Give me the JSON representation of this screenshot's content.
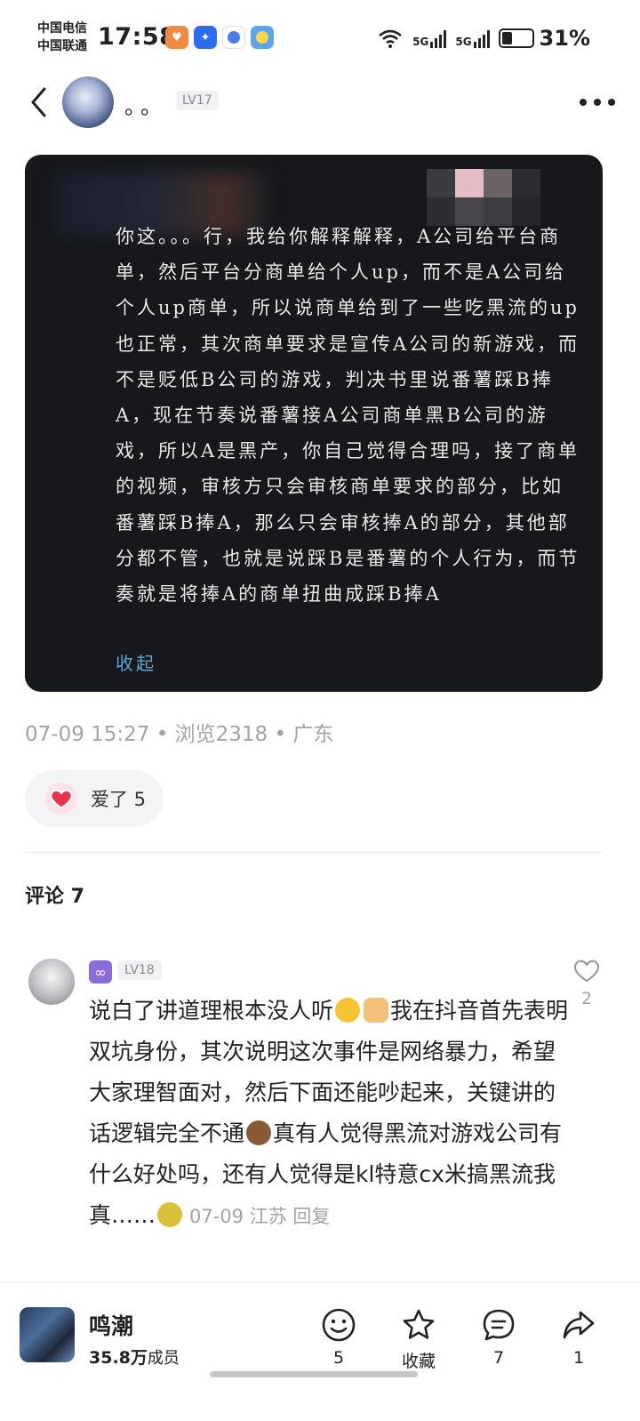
{
  "status_bar": {
    "carrier_1": "中国电信",
    "carrier_2": "中国联通",
    "time": "17:58",
    "network_1": "6",
    "network_2": "5G",
    "network_3": "5G",
    "battery_percent": "31%",
    "battery_level": 0.31
  },
  "header": {
    "user_name": "。。",
    "level": "LV17"
  },
  "post": {
    "text": "你这。。。行，我给你解释解释，A公司给平台商单，然后平台分商单给个人up，而不是A公司给个人up商单，所以说商单给到了一些吃黑流的up也正常，其次商单要求是宣传A公司的新游戏，而不是贬低B公司的游戏，判决书里说番薯踩B捧A，现在节奏说番薯接A公司商单黑B公司的游戏，所以A是黑产，你自己觉得合理吗，接了商单的视频，审核方只会审核商单要求的部分，比如番薯踩B捧A，那么只会审核捧A的部分，其他部分都不管，也就是说踩B是番薯的个人行为，而节奏就是将捧A的商单扭曲成踩B捧A",
    "collapse_label": "收起",
    "meta": "07-09 15:27 • 浏览2318 • 广东",
    "like_label": "爱了 5"
  },
  "comments": {
    "title": "评论 7",
    "items": [
      {
        "level": "LV18",
        "badge_icon": "∞",
        "like_count": "2",
        "text_part1": "说白了讲道理根本没人听",
        "text_part2": "我在抖音首先表明双坑身份，其次说明这次事件是网络暴力，希望大家理智面对，然后下面还能吵起来，关键讲的话逻辑完全不通",
        "text_part3": "真有人觉得黑流对游戏公司有什么好处吗，还有人觉得是kl特意cx米搞黑流我真……",
        "meta": "07-09 江苏 回复"
      }
    ]
  },
  "bottom_bar": {
    "community_name": "鸣潮",
    "members_count": "35.8万",
    "members_suffix": "成员",
    "emoji_count": "5",
    "favorite_label": "收藏",
    "comment_count": "7",
    "share_count": "1"
  },
  "colors": {
    "accent_link": "#5ea8d8",
    "heart": "#e8334f",
    "muted_text": "#a2a2a7"
  },
  "icons": [
    "back-icon",
    "more-icon",
    "heart-icon",
    "smile-icon",
    "star-icon",
    "comment-icon",
    "share-icon"
  ]
}
